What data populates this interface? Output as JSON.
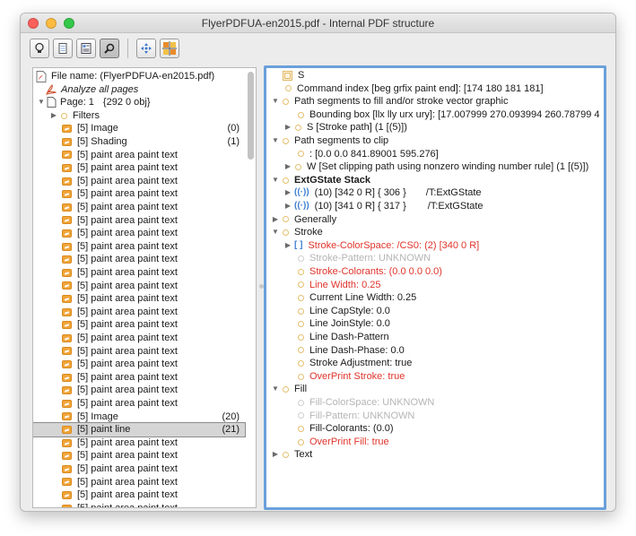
{
  "window": {
    "title": "FlyerPDFUA-en2015.pdf - Internal PDF structure"
  },
  "toolbar": {
    "buttons": [
      {
        "name": "lightbulb-icon",
        "active": false
      },
      {
        "name": "page-icon",
        "active": false
      },
      {
        "name": "document-outline-icon",
        "active": false
      },
      {
        "name": "search-icon",
        "active": true
      },
      {
        "name": "move-arrows-icon",
        "active": false
      },
      {
        "name": "grid-color-icon",
        "active": false
      }
    ]
  },
  "left_tree": {
    "file_name": "File name: (FlyerPDFUA-en2015.pdf)",
    "analyze": "Analyze all pages",
    "page": "Page: 1",
    "page_obj": "{292 0 obj}",
    "filters": "Filters",
    "items": [
      {
        "label": "[5] Image",
        "count": "(0)"
      },
      {
        "label": "[5] Shading",
        "count": "(1)"
      },
      {
        "label": "[5] paint area paint text",
        "count": ""
      },
      {
        "label": "[5] paint area paint text",
        "count": ""
      },
      {
        "label": "[5] paint area paint text",
        "count": ""
      },
      {
        "label": "[5] paint area paint text",
        "count": ""
      },
      {
        "label": "[5] paint area paint text",
        "count": ""
      },
      {
        "label": "[5] paint area paint text",
        "count": ""
      },
      {
        "label": "[5] paint area paint text",
        "count": ""
      },
      {
        "label": "[5] paint area paint text",
        "count": ""
      },
      {
        "label": "[5] paint area paint text",
        "count": ""
      },
      {
        "label": "[5] paint area paint text",
        "count": ""
      },
      {
        "label": "[5] paint area paint text",
        "count": ""
      },
      {
        "label": "[5] paint area paint text",
        "count": ""
      },
      {
        "label": "[5] paint area paint text",
        "count": ""
      },
      {
        "label": "[5] paint area paint text",
        "count": ""
      },
      {
        "label": "[5] paint area paint text",
        "count": ""
      },
      {
        "label": "[5] paint area paint text",
        "count": ""
      },
      {
        "label": "[5] paint area paint text",
        "count": ""
      },
      {
        "label": "[5] paint area paint text",
        "count": ""
      },
      {
        "label": "[5] paint area paint text",
        "count": ""
      },
      {
        "label": "[5] paint area paint text",
        "count": ""
      },
      {
        "label": "[5] Image",
        "count": "(20)"
      },
      {
        "label": "[5] paint line",
        "count": "(21)",
        "selected": true
      },
      {
        "label": "[5] paint area paint text",
        "count": ""
      },
      {
        "label": "[5] paint area paint text",
        "count": ""
      },
      {
        "label": "[5] paint area paint text",
        "count": ""
      },
      {
        "label": "[5] paint area paint text",
        "count": ""
      },
      {
        "label": "[5] paint area paint text",
        "count": ""
      },
      {
        "label": "[5] paint area paint text",
        "count": ""
      },
      {
        "label": "[5] paint area paint text",
        "count": ""
      },
      {
        "label": "[5] paint area paint text",
        "count": ""
      },
      {
        "label": "[5] paint area paint text",
        "count": ""
      }
    ]
  },
  "right_tree": {
    "s_label": "S",
    "command_index": "Command index [beg grfix paint end]:  [174 180 181 181]",
    "path_fill": "Path segments to fill and/or stroke vector graphic",
    "bounding_box": "Bounding box [llx lly urx ury]: [17.007999  270.093994  260.78799  4",
    "s_stroke": "S  [Stroke path]  (1  [(5)])",
    "path_clip": "Path segments to clip",
    "clip_values": ": [0.0  0.0  841.89001  595.276]",
    "w_clip": "W  [Set clipping path using nonzero winding number rule]  (1  [(5)])",
    "extgstate": "ExtGState Stack",
    "ext1_ref": "(10) [342 0 R]   { 306 }",
    "ext1_type": "/T:ExtGState",
    "ext2_ref": "(10) [341 0 R]   { 317 }",
    "ext2_type": "/T:ExtGState",
    "generally": "Generally",
    "stroke": "Stroke",
    "stroke_colorspace": "Stroke-ColorSpace:  /CS0:   (2)  [340 0 R]",
    "stroke_pattern": "Stroke-Pattern: UNKNOWN",
    "stroke_colorants": "Stroke-Colorants: (0.0  0.0  0.0)",
    "line_width": "Line Width: 0.25",
    "current_line_width": "Current Line Width: 0.25",
    "line_capstyle": "Line CapStyle: 0.0",
    "line_joinstyle": "Line JoinStyle: 0.0",
    "line_dash_pattern": "Line Dash-Pattern",
    "line_dash_phase": "Line Dash-Phase: 0.0",
    "stroke_adjustment": "Stroke Adjustment: true",
    "overprint_stroke": "OverPrint Stroke: true",
    "fill": "Fill",
    "fill_colorspace": "Fill-ColorSpace: UNKNOWN",
    "fill_pattern": "Fill-Pattern: UNKNOWN",
    "fill_colorants": "Fill-Colorants: (0.0)",
    "overprint_fill": "OverPrint Fill: true",
    "text": "Text"
  },
  "icons": {
    "expand": "▶",
    "collapse": "▼",
    "bracket_glyph": "[ ]",
    "paren_glyph": "((·))"
  },
  "colors": {
    "accent_red": "#e0342b",
    "selection_border": "#6aa0db",
    "pen_orange": "#f1a53a"
  }
}
